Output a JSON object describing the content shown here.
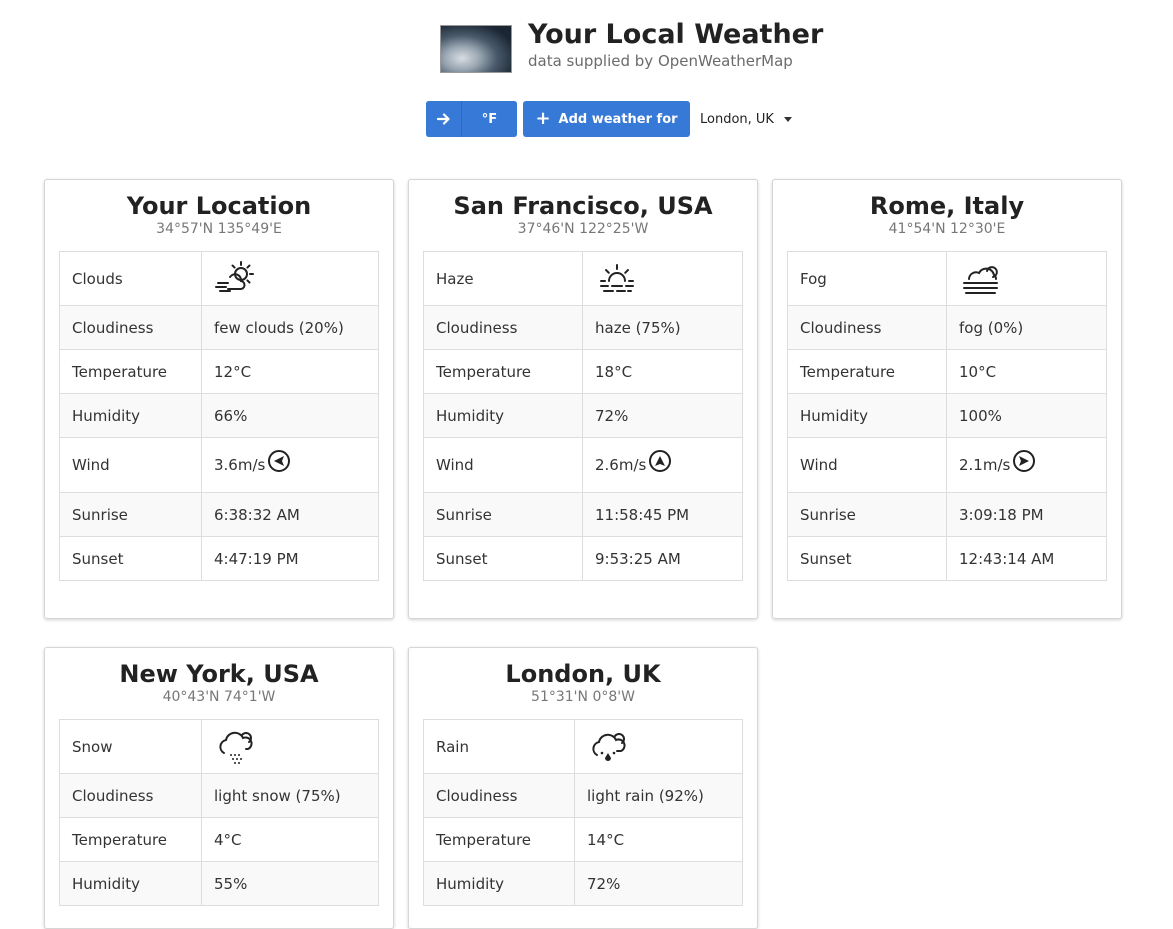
{
  "header": {
    "title": "Your Local Weather",
    "subtitle": "data supplied by OpenWeatherMap"
  },
  "controls": {
    "unit_label": "°F",
    "add_label": "Add weather for",
    "city_select_value": "London, UK"
  },
  "cards": [
    {
      "name": "Your Location",
      "coords": "34°57'N 135°49'E",
      "condition": "Clouds",
      "icon": "cloudy-day-windy-icon",
      "rows": [
        {
          "label": "Cloudiness",
          "value": "few clouds (20%)"
        },
        {
          "label": "Temperature",
          "value": "12°C"
        },
        {
          "label": "Humidity",
          "value": "66%"
        },
        {
          "label": "Wind",
          "value": "3.6m/s"
        },
        {
          "label": "Sunrise",
          "value": "6:38:32 AM"
        },
        {
          "label": "Sunset",
          "value": "4:47:19 PM"
        }
      ]
    },
    {
      "name": "San Francisco, USA",
      "coords": "37°46'N 122°25'W",
      "condition": "Haze",
      "icon": "haze-icon",
      "rows": [
        {
          "label": "Cloudiness",
          "value": "haze (75%)"
        },
        {
          "label": "Temperature",
          "value": "18°C"
        },
        {
          "label": "Humidity",
          "value": "72%"
        },
        {
          "label": "Wind",
          "value": "2.6m/s"
        },
        {
          "label": "Sunrise",
          "value": "11:58:45 PM"
        },
        {
          "label": "Sunset",
          "value": "9:53:25 AM"
        }
      ]
    },
    {
      "name": "Rome, Italy",
      "coords": "41°54'N 12°30'E",
      "condition": "Fog",
      "icon": "fog-icon",
      "rows": [
        {
          "label": "Cloudiness",
          "value": "fog (0%)"
        },
        {
          "label": "Temperature",
          "value": "10°C"
        },
        {
          "label": "Humidity",
          "value": "100%"
        },
        {
          "label": "Wind",
          "value": "2.1m/s"
        },
        {
          "label": "Sunrise",
          "value": "3:09:18 PM"
        },
        {
          "label": "Sunset",
          "value": "12:43:14 AM"
        }
      ]
    },
    {
      "name": "New York, USA",
      "coords": "40°43'N 74°1'W",
      "condition": "Snow",
      "icon": "snow-icon",
      "rows": [
        {
          "label": "Cloudiness",
          "value": "light snow (75%)"
        },
        {
          "label": "Temperature",
          "value": "4°C"
        },
        {
          "label": "Humidity",
          "value": "55%"
        }
      ]
    },
    {
      "name": "London, UK",
      "coords": "51°31'N 0°8'W",
      "condition": "Rain",
      "icon": "rain-icon",
      "rows": [
        {
          "label": "Cloudiness",
          "value": "light rain (92%)"
        },
        {
          "label": "Temperature",
          "value": "14°C"
        },
        {
          "label": "Humidity",
          "value": "72%"
        }
      ]
    }
  ],
  "colors": {
    "primary": "#3779d6",
    "border": "#dddddd",
    "muted": "#777777"
  }
}
